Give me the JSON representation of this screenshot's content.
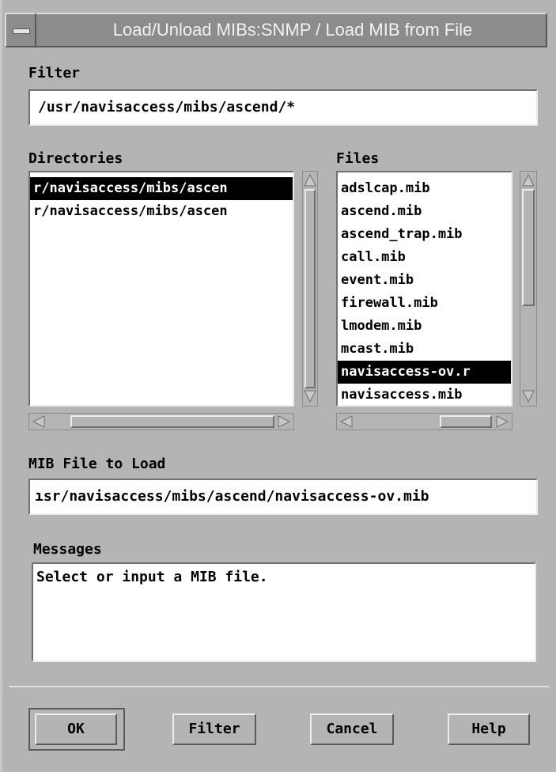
{
  "window": {
    "title": "Load/Unload MIBs:SNMP / Load MIB from File"
  },
  "filter": {
    "label": "Filter",
    "value": "/usr/navisaccess/mibs/ascend/*"
  },
  "directories": {
    "label": "Directories",
    "items": [
      {
        "label": "r/navisaccess/mibs/ascen",
        "selected": true
      },
      {
        "label": "r/navisaccess/mibs/ascen",
        "selected": false
      }
    ]
  },
  "files": {
    "label": "Files",
    "items": [
      {
        "label": "adslcap.mib",
        "selected": false
      },
      {
        "label": "ascend.mib",
        "selected": false
      },
      {
        "label": "ascend_trap.mib",
        "selected": false
      },
      {
        "label": "call.mib",
        "selected": false
      },
      {
        "label": "event.mib",
        "selected": false
      },
      {
        "label": "firewall.mib",
        "selected": false
      },
      {
        "label": "lmodem.mib",
        "selected": false
      },
      {
        "label": "mcast.mib",
        "selected": false
      },
      {
        "label": "navisaccess-ov.r",
        "selected": true
      },
      {
        "label": "navisaccess.mib",
        "selected": false
      }
    ]
  },
  "mib_file": {
    "label": "MIB File to Load",
    "value": "ısr/navisaccess/mibs/ascend/navisaccess-ov.mib"
  },
  "messages": {
    "label": "Messages",
    "text": "Select or input a MIB file."
  },
  "buttons": {
    "ok": "OK",
    "filter": "Filter",
    "cancel": "Cancel",
    "help": "Help"
  },
  "icons": {
    "system_menu": "window-menu-icon",
    "scroll_up": "arrow-up-icon",
    "scroll_down": "arrow-down-icon",
    "scroll_left": "arrow-left-icon",
    "scroll_right": "arrow-right-icon"
  }
}
